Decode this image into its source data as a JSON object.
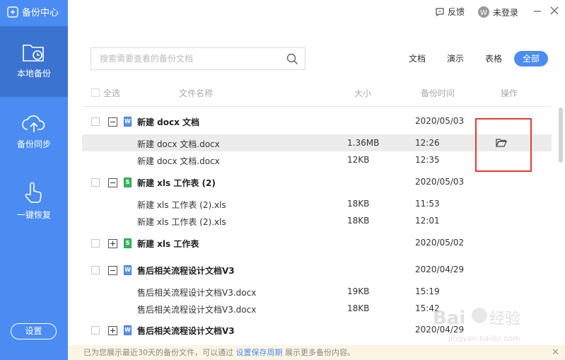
{
  "app": {
    "title": "备份中心"
  },
  "sidebar": {
    "items": [
      {
        "label": "本地备份",
        "icon": "folder-clock-icon"
      },
      {
        "label": "备份同步",
        "icon": "cloud-upload-icon"
      },
      {
        "label": "一键恢复",
        "icon": "hand-tap-icon"
      }
    ],
    "settings_label": "设置"
  },
  "topbar": {
    "feedback": "反馈",
    "login": "未登录"
  },
  "search": {
    "placeholder": "搜索需要查看的备份文档"
  },
  "filters": [
    "文档",
    "演示",
    "表格",
    "全部"
  ],
  "table": {
    "headers": {
      "select_all": "全选",
      "name": "文件名称",
      "size": "大小",
      "time": "备份时间",
      "action": "操作"
    },
    "groups": [
      {
        "name": "新建 docx 文档",
        "date": "2020/05/03",
        "type": "W",
        "expanded": true,
        "files": [
          {
            "name": "新建 docx 文档.docx",
            "size": "1.36MB",
            "time": "12:26"
          },
          {
            "name": "新建 docx 文档.docx",
            "size": "12KB",
            "time": "12:35"
          }
        ]
      },
      {
        "name": "新建 xls 工作表 (2)",
        "date": "2020/05/03",
        "type": "S",
        "expanded": true,
        "files": [
          {
            "name": "新建 xls 工作表 (2).xls",
            "size": "18KB",
            "time": "11:53"
          },
          {
            "name": "新建 xls 工作表 (2).xls",
            "size": "18KB",
            "time": "12:01"
          }
        ]
      },
      {
        "name": "新建 xls 工作表",
        "date": "2020/05/02",
        "type": "S",
        "expanded": false,
        "files": []
      },
      {
        "name": "售后相关流程设计文档V3",
        "date": "2020/04/29",
        "type": "W",
        "expanded": true,
        "files": [
          {
            "name": "售后相关流程设计文档V3.docx",
            "size": "19KB",
            "time": "15:19"
          },
          {
            "name": "售后相关流程设计文档V3.docx",
            "size": "18KB",
            "time": "15:42"
          }
        ]
      },
      {
        "name": "售后相关流程设计文档V3",
        "date": "2020/04/29",
        "type": "W",
        "expanded": false,
        "files": []
      }
    ]
  },
  "notice": {
    "text": "已为您展示最近30天的备份文件，可以通过",
    "link": "设置保存周期",
    "suffix": "展示更多备份内容。"
  },
  "watermark": {
    "text": "Baidu经验",
    "url_text": "jingyan.baidu.com"
  },
  "colors": {
    "accent": "#4a8cf1",
    "highlight": "#e53935"
  }
}
